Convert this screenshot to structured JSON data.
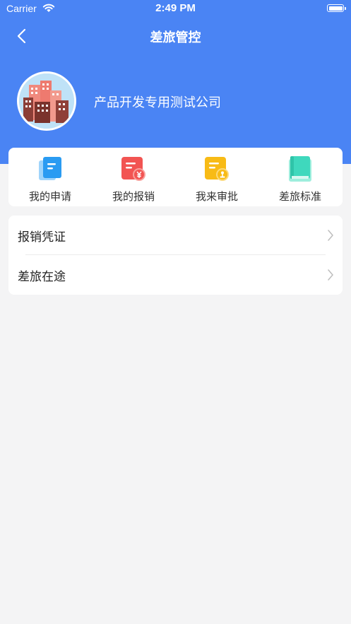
{
  "status_bar": {
    "carrier": "Carrier",
    "time": "2:49 PM"
  },
  "nav": {
    "title": "差旅管控",
    "back_icon": "chevron-left-icon"
  },
  "profile": {
    "company_name": "产品开发专用测试公司"
  },
  "quick_actions": [
    {
      "label": "我的申请",
      "icon": "application-doc-icon",
      "color": "#2a9bf2"
    },
    {
      "label": "我的报销",
      "icon": "reimbursement-yen-icon",
      "color": "#f25452"
    },
    {
      "label": "我来审批",
      "icon": "approval-stamp-icon",
      "color": "#f8bb16"
    },
    {
      "label": "差旅标准",
      "icon": "book-icon",
      "color": "#3fd8bd"
    }
  ],
  "menu": [
    {
      "label": "报销凭证"
    },
    {
      "label": "差旅在途"
    }
  ],
  "colors": {
    "header": "#4a84f4",
    "background": "#f4f4f5"
  }
}
